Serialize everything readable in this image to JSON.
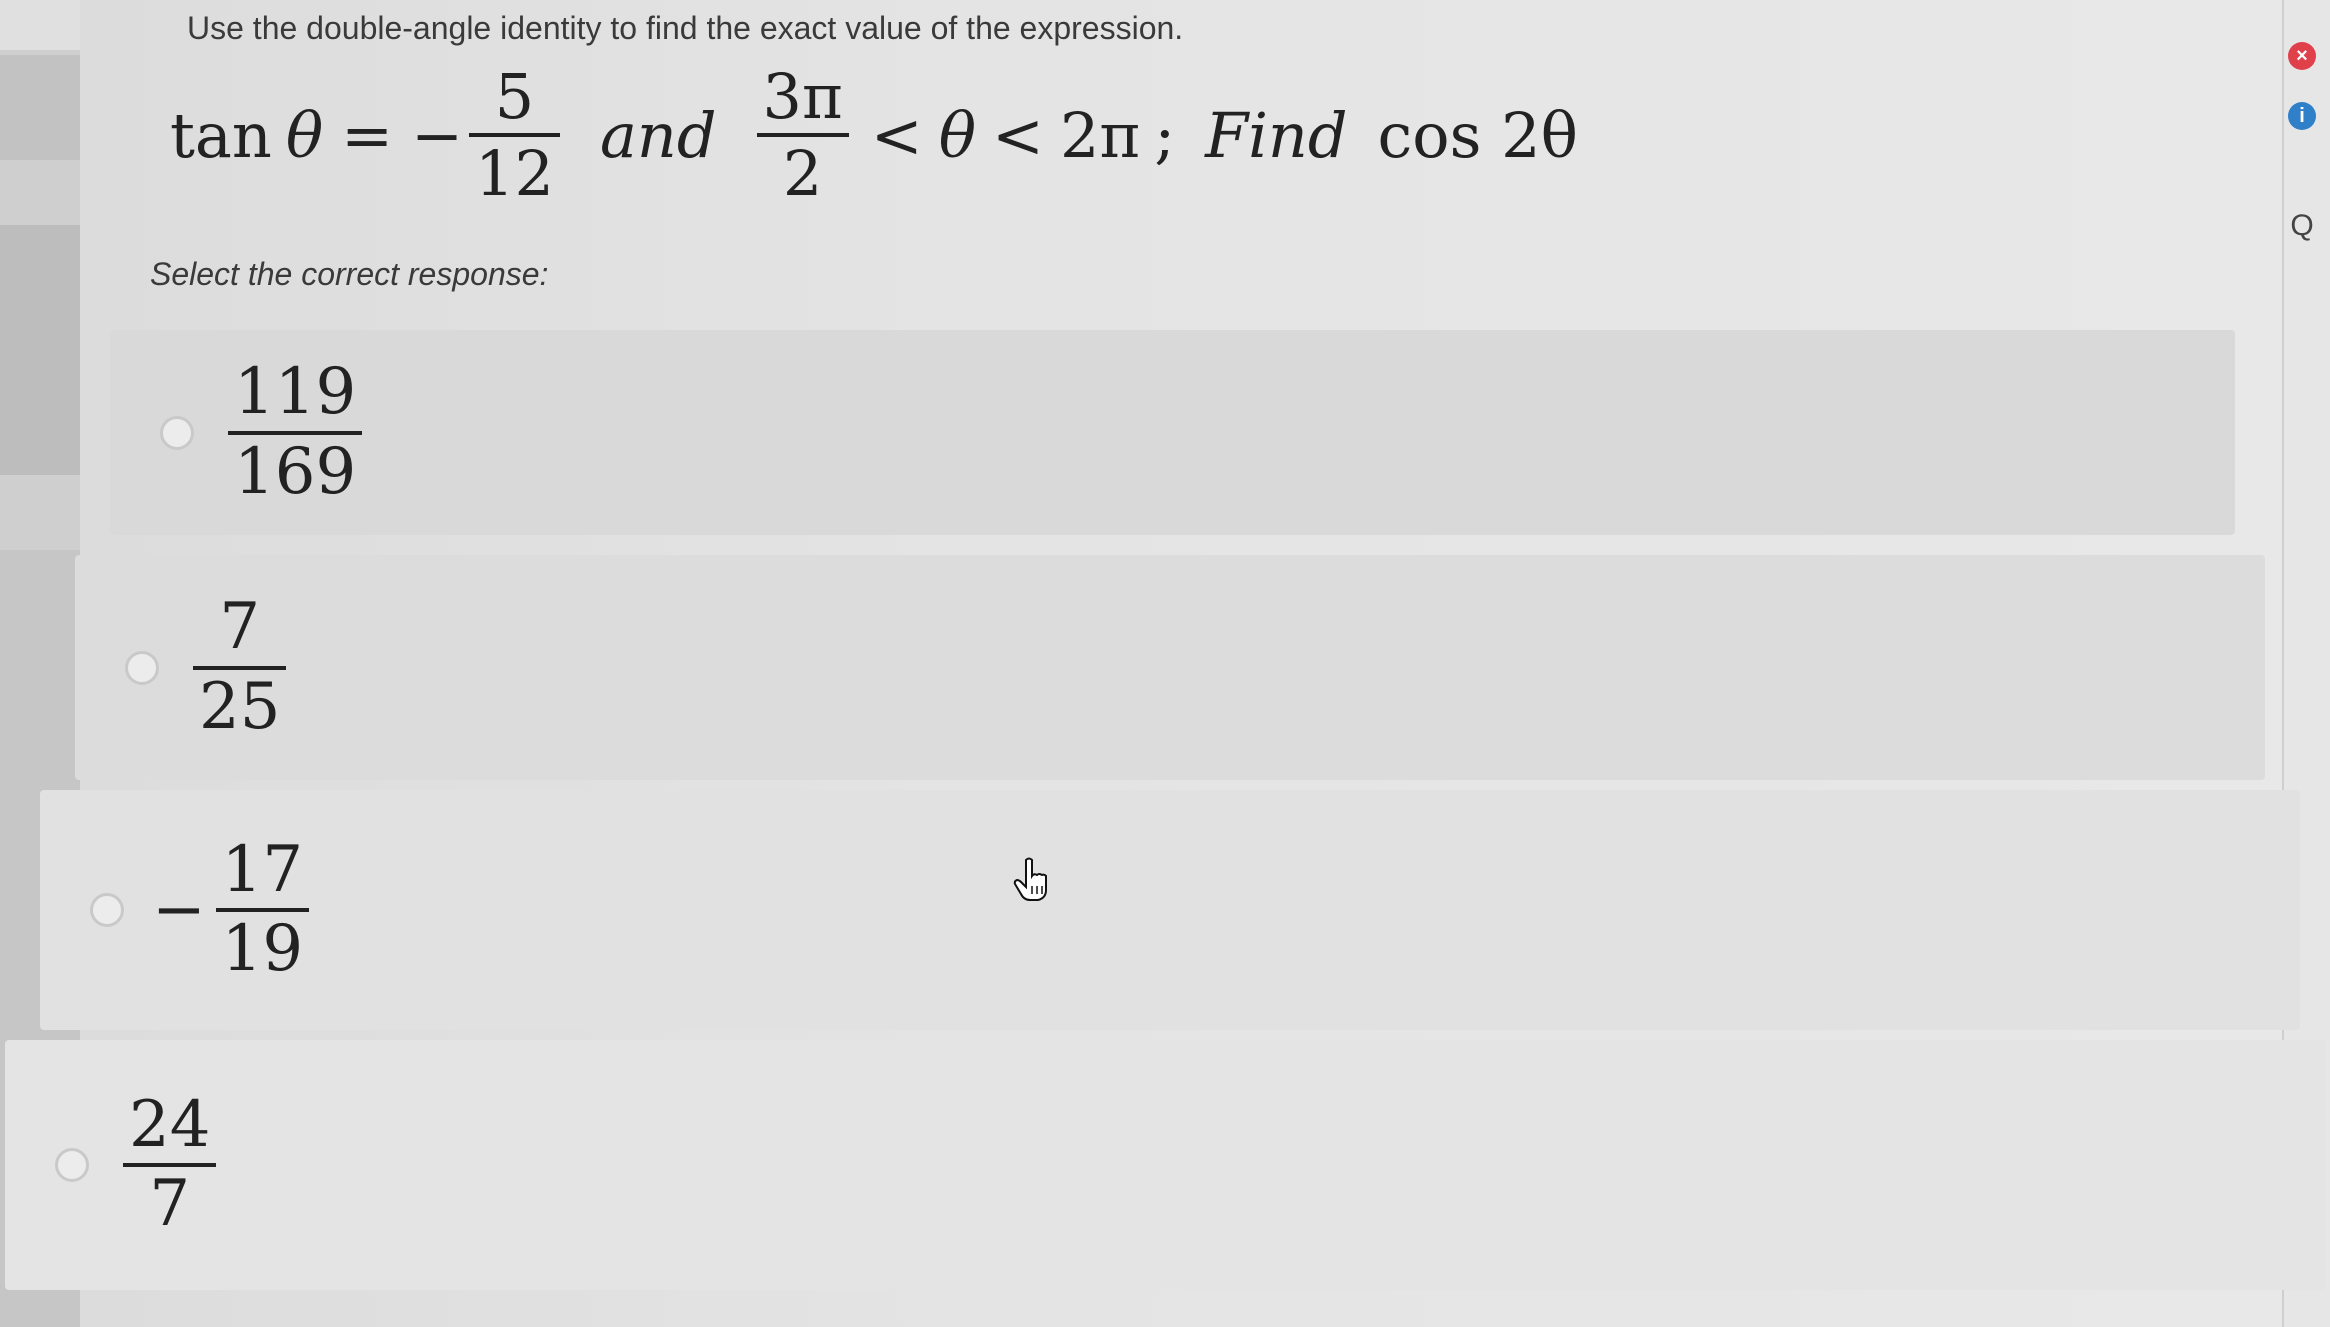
{
  "question": {
    "instruction": "Use the double-angle identity to find the exact value of the expression.",
    "expression": {
      "tan_label": "tan",
      "theta": "θ",
      "equals": "=",
      "tan_sign": "−",
      "tan_num": "5",
      "tan_den": "12",
      "and_word": "and",
      "lower_num": "3π",
      "lower_den": "2",
      "lt": "<",
      "upper": "2π",
      "sep": ";",
      "find_word": "Find",
      "target": "cos 2θ"
    },
    "prompt": "Select the correct response:"
  },
  "choices": [
    {
      "sign": "",
      "num": "119",
      "den": "169"
    },
    {
      "sign": "",
      "num": "7",
      "den": "25"
    },
    {
      "sign": "−",
      "num": "17",
      "den": "19"
    },
    {
      "sign": "",
      "num": "24",
      "den": "7"
    }
  ],
  "icons": {
    "close": "close-icon",
    "info": "info-icon",
    "search": "search-icon",
    "pointer": "hand-pointer-icon"
  },
  "colors": {
    "close": "#e0404a",
    "info": "#2f7fc9"
  }
}
